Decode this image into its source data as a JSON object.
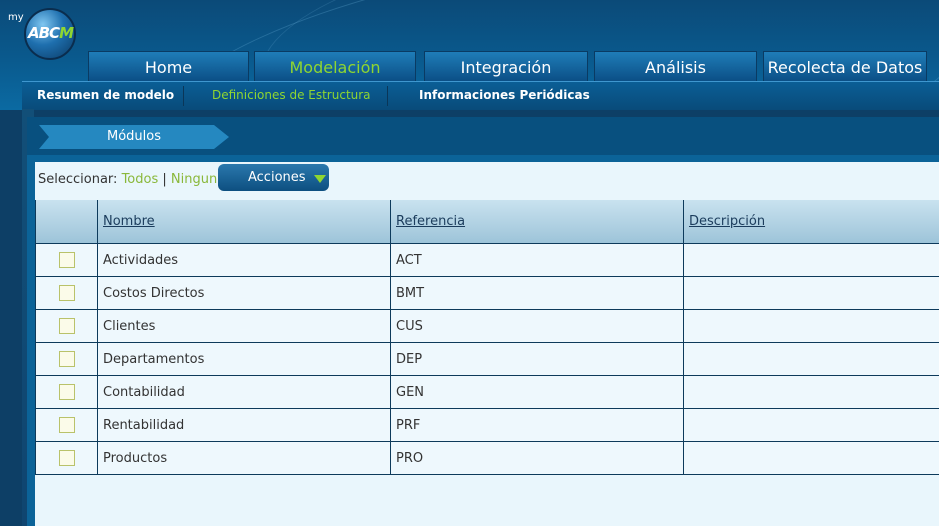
{
  "app": {
    "logo_prefix": "my",
    "logo_abc": "ABC",
    "logo_m": "M"
  },
  "main_tabs": [
    {
      "label": "Home",
      "active": false
    },
    {
      "label": "Modelación",
      "active": true
    },
    {
      "label": "Integración",
      "active": false
    },
    {
      "label": "Análisis",
      "active": false
    },
    {
      "label": "Recolecta de Datos",
      "active": false
    }
  ],
  "sub_tabs": [
    {
      "label": "Resumen de modelo",
      "active": false
    },
    {
      "label": "Definiciones de Estructura",
      "active": true
    },
    {
      "label": "Informaciones Periódicas",
      "active": false
    }
  ],
  "breadcrumb": "Módulos",
  "toolbar": {
    "select_label": "Seleccionar:",
    "all": "Todos",
    "separator": "|",
    "none": "Ninguno",
    "actions": "Acciones"
  },
  "table": {
    "columns": [
      "Nombre",
      "Referencia",
      "Descripción"
    ],
    "rows": [
      {
        "name": "Actividades",
        "ref": "ACT",
        "desc": ""
      },
      {
        "name": "Costos Directos",
        "ref": "BMT",
        "desc": ""
      },
      {
        "name": "Clientes",
        "ref": "CUS",
        "desc": ""
      },
      {
        "name": "Departamentos",
        "ref": "DEP",
        "desc": ""
      },
      {
        "name": "Contabilidad",
        "ref": "GEN",
        "desc": ""
      },
      {
        "name": "Rentabilidad",
        "ref": "PRF",
        "desc": ""
      },
      {
        "name": "Productos",
        "ref": "PRO",
        "desc": ""
      }
    ]
  },
  "colors": {
    "accent_green": "#8fd631",
    "header_blue": "#0b5a8e",
    "content_bg": "#e9f6fc"
  }
}
